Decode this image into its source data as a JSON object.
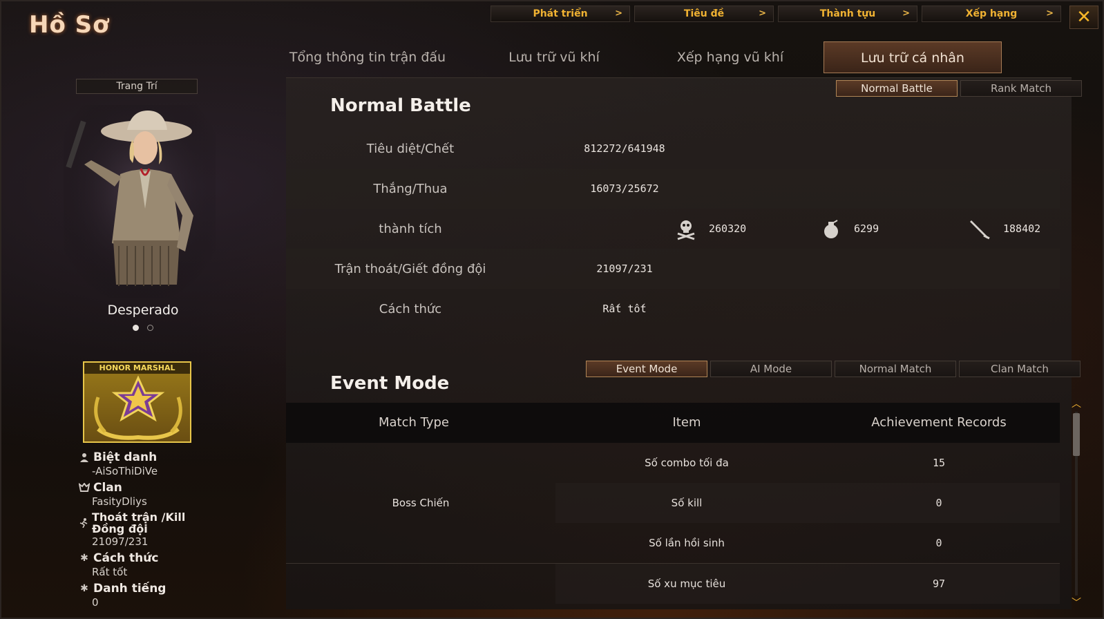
{
  "window": {
    "title": "Hồ Sơ",
    "close_glyph": "✕"
  },
  "topnav": [
    {
      "label": "Phát triển",
      "chev": ">"
    },
    {
      "label": "Tiêu đề",
      "chev": ">"
    },
    {
      "label": "Thành tựu",
      "chev": ">"
    },
    {
      "label": "Xếp hạng",
      "chev": ">"
    }
  ],
  "tabs": [
    {
      "label": "Tổng thông tin trận đấu"
    },
    {
      "label": "Lưu trữ vũ khí"
    },
    {
      "label": "Xếp hạng vũ khí"
    },
    {
      "label": "Lưu trữ cá nhân",
      "active": true
    }
  ],
  "left": {
    "decorate_label": "Trang Trí",
    "character_name": "Desperado",
    "badge_text": "HONOR MARSHAL",
    "info": [
      {
        "icon": "user-icon",
        "label": "Biệt danh",
        "value": "-AiSoThiDiVe"
      },
      {
        "icon": "clan-icon",
        "label": "Clan",
        "value": "FasityDliys"
      },
      {
        "icon": "run-icon",
        "label": "Thoát trận /Kill Đồng đội",
        "value": "21097/231"
      },
      {
        "icon": "gear-icon",
        "label": "Cách thức",
        "value": "Rất tốt"
      },
      {
        "icon": "gear-icon",
        "label": "Danh tiếng",
        "value": "0"
      }
    ]
  },
  "normal_battle": {
    "title": "Normal Battle",
    "mode_tabs": [
      {
        "label": "Normal Battle",
        "active": true
      },
      {
        "label": "Rank Match"
      }
    ],
    "rows": [
      {
        "label": "Tiêu diệt/Chết",
        "value": "812272/641948"
      },
      {
        "label": "Thắng/Thua",
        "value": "16073/25672"
      },
      {
        "label": "thành tích",
        "value": ""
      },
      {
        "label": "Trận thoát/Giết đồng đội",
        "value": "21097/231"
      },
      {
        "label": "Cách thức",
        "value": "Rất tốt"
      }
    ],
    "achievements": [
      {
        "icon": "skull-icon",
        "value": "260320"
      },
      {
        "icon": "grenade-icon",
        "value": "6299"
      },
      {
        "icon": "knife-icon",
        "value": "188402"
      }
    ]
  },
  "event_mode": {
    "title": "Event Mode",
    "mode_tabs": [
      {
        "label": "Event Mode",
        "active": true
      },
      {
        "label": "AI Mode"
      },
      {
        "label": "Normal Match"
      },
      {
        "label": "Clan Match"
      }
    ],
    "columns": [
      "Match Type",
      "Item",
      "Achievement Records"
    ],
    "match_type": "Boss Chiến",
    "rows": [
      {
        "item": "Số combo tối đa",
        "value": "15"
      },
      {
        "item": "Số kill",
        "value": "0"
      },
      {
        "item": "Số lần hồi sinh",
        "value": "0"
      },
      {
        "item": "Số xu mục tiêu",
        "value": "97"
      }
    ]
  },
  "colors": {
    "accent": "#f0b232",
    "active_tab": "#5b3a26",
    "active_border": "#a87c56"
  }
}
